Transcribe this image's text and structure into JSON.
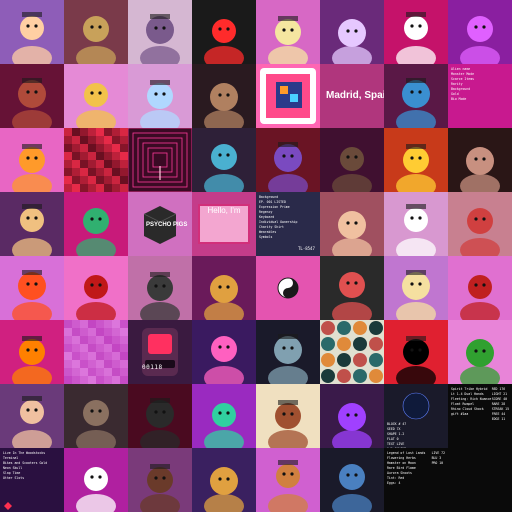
{
  "grid": {
    "columns": 8,
    "rows": 8,
    "tiles": [
      {
        "bg": "#8e5db8",
        "fg": "#ffcfa3",
        "icon": "robot-avatar"
      },
      {
        "bg": "#7a3a4a",
        "fg": "#c8a15a",
        "icon": "samurai-figure"
      },
      {
        "bg": "#d5b7d2",
        "fg": "#7a5a8c",
        "icon": "pixel-knight"
      },
      {
        "bg": "#1a1a1a",
        "fg": "#ff2b2b",
        "icon": "pixel-punk"
      },
      {
        "bg": "#d768c5",
        "fg": "#f5e6a0",
        "icon": "punk-glasses"
      },
      {
        "bg": "#6a2a7a",
        "fg": "#e6c8ff",
        "icon": "city-skyline"
      },
      {
        "bg": "#c5126a",
        "fg": "#ffffff",
        "icon": "panda"
      },
      {
        "bg": "#8a1fa0",
        "fg": "#e060ff",
        "icon": "hooded-figure"
      },
      {
        "bg": "#661236",
        "fg": "#b04a3a",
        "icon": "gun-art"
      },
      {
        "bg": "#e58ad6",
        "fg": "#f2c24a",
        "icon": "cat-cap"
      },
      {
        "bg": "#d99ad6",
        "fg": "#b0d8ff",
        "icon": "mushroom"
      },
      {
        "bg": "#2a1a20",
        "fg": "#b08060",
        "icon": "creature-3d"
      },
      {
        "bg": "#ff66b3",
        "fg": "#ffffff",
        "icon": "app-cube"
      },
      {
        "bg": "#b0367d",
        "fg": "#ffffff",
        "icon": "city-card",
        "text": "Madrid, Spai"
      },
      {
        "bg": "#5a1846",
        "fg": "#3a8fd0",
        "icon": "alien-portrait"
      },
      {
        "bg": "#c8198f",
        "fg": "#ffffff",
        "icon": "text-list",
        "lines": [
          "Alien name",
          "Monster Mode",
          "Scarce Items",
          "Rarity",
          "Background",
          "Gold",
          "Bio Mode"
        ]
      },
      {
        "bg": "#e866c4",
        "fg": "#ff9a2a",
        "icon": "fox-pirate"
      },
      {
        "bg": "#5a0c1c",
        "fg": "#ff3050",
        "icon": "glitch-texture"
      },
      {
        "bg": "#3a0a24",
        "fg": "#ff3a9a",
        "icon": "tunnel"
      },
      {
        "bg": "#2e2038",
        "fg": "#4ab0d0",
        "icon": "doll-girl"
      },
      {
        "bg": "#6a1424",
        "fg": "#7a4ac0",
        "icon": "monster-pose"
      },
      {
        "bg": "#401030",
        "fg": "#6a4a3a",
        "icon": "woman-portrait"
      },
      {
        "bg": "#c83a1a",
        "fg": "#ffcc33",
        "icon": "ornament"
      },
      {
        "bg": "#2a1616",
        "fg": "#c89080",
        "icon": "figure-photo"
      },
      {
        "bg": "#5a2a64",
        "fg": "#f0c080",
        "icon": "pixel-king"
      },
      {
        "bg": "#c81a7a",
        "fg": "#30b070",
        "icon": "dragon"
      },
      {
        "bg": "#d070c0",
        "fg": "#2a2a2a",
        "icon": "psycho-cube",
        "text": "PSYCHO PIGS"
      },
      {
        "bg": "#c43c8a",
        "fg": "#c0185a",
        "icon": "hello-card",
        "text": "Hello, I'm"
      },
      {
        "bg": "#2a2a4a",
        "fg": "#ffffff",
        "icon": "info-list",
        "lines": [
          "Background",
          "EP. 001 LISTED",
          "Expression Prime",
          "Regency",
          "Keyboard",
          "Individual Ownership",
          "Charity Shirt",
          "Wearables",
          "Symbols"
        ],
        "code": "TL-8547"
      },
      {
        "bg": "#a05060",
        "fg": "#f0c0a0",
        "icon": "kiss-photo"
      },
      {
        "bg": "#d898d0",
        "fg": "#ffffff",
        "icon": "cat-cartoon"
      },
      {
        "bg": "#c88090",
        "fg": "#d04040",
        "icon": "landscape"
      },
      {
        "bg": "#d870d8",
        "fg": "#ff5020",
        "icon": "bird-hero"
      },
      {
        "bg": "#f070c8",
        "fg": "#c01818",
        "icon": "red-ball-pixel"
      },
      {
        "bg": "#c070a8",
        "fg": "#3a3a3a",
        "icon": "horse-shadows"
      },
      {
        "bg": "#6a1a5a",
        "fg": "#e0a040",
        "icon": "tiger-woman"
      },
      {
        "bg": "#e454b0",
        "fg": "#1a1a1a",
        "icon": "yin-yang"
      },
      {
        "bg": "#2a2a2a",
        "fg": "#e05050",
        "icon": "mermaid"
      },
      {
        "bg": "#c076d0",
        "fg": "#f5e0a0",
        "icon": "bearded-cube"
      },
      {
        "bg": "#e070d0",
        "fg": "#c02020",
        "icon": "monkey"
      },
      {
        "bg": "#d02080",
        "fg": "#ff8000",
        "icon": "fist-astronaut"
      },
      {
        "bg": "#c040c0",
        "fg": "#e080e0",
        "icon": "blurred-pixel"
      },
      {
        "bg": "#3a1a40",
        "fg": "#ff3060",
        "icon": "counter-device",
        "text": "00118"
      },
      {
        "bg": "#3a1a60",
        "fg": "#ff60c0",
        "icon": "octopus-bot"
      },
      {
        "bg": "#1a1a2a",
        "fg": "#80a0b0",
        "icon": "dragon-head"
      },
      {
        "bg": "#e0e0d0",
        "fg": "#1a1a1a",
        "icon": "geometric-pattern"
      },
      {
        "bg": "#e02030",
        "fg": "#000000",
        "icon": "ink-face"
      },
      {
        "bg": "#e884d8",
        "fg": "#30a030",
        "icon": "pepe-soldier"
      },
      {
        "bg": "#6a3a7a",
        "fg": "#f0c0a0",
        "icon": "bald-man"
      },
      {
        "bg": "#3a2a30",
        "fg": "#8a7060",
        "icon": "beast-mech"
      },
      {
        "bg": "#4a0a20",
        "fg": "#2a2a2a",
        "icon": "dark-mech"
      },
      {
        "bg": "#9a2ac0",
        "fg": "#30d0a0",
        "icon": "dog-jester"
      },
      {
        "bg": "#f0e0c0",
        "fg": "#a05030",
        "icon": "anime-girl"
      },
      {
        "bg": "#3a1a4a",
        "fg": "#a040ff",
        "icon": "purple-monster"
      },
      {
        "bg": "#1a1a2a",
        "fg": "#6080ff",
        "icon": "planet-text",
        "lines": [
          "BLOCK # 47",
          "SEED 7X",
          "SHAPE 1.2",
          "FLAT 0",
          "TEXT LIVE",
          "1/1 ONLINE"
        ]
      },
      {
        "bg": "#0a0a0a",
        "fg": "#ffffff",
        "icon": "metadata",
        "lines": [
          "Spirit Tribe Hybrid",
          "Lt 1.4 Dual Hands",
          "Fleeting: Rich Nuance",
          "Float Rumpel",
          "Rhino Cloud Shock",
          "gift #1aa"
        ],
        "side": [
          "RED 176",
          "LIGHT 21",
          "SCORE 40",
          "RARE 28",
          "STREAK 15",
          "FREE 44",
          "EDGE 11"
        ]
      },
      {
        "bg": "#2a1040",
        "fg": "#ffffff",
        "icon": "terminal-list",
        "lines": [
          "Live In The Woodstocks",
          "Terminal",
          "Bikes and Scooters Gold",
          "Neon Skull",
          "Slap Time",
          "Other Slots"
        ]
      },
      {
        "bg": "#b020a0",
        "fg": "#ffffff",
        "icon": "retro-computer"
      },
      {
        "bg": "#7a3a7a",
        "fg": "#6a3a2a",
        "icon": "desert-landscape"
      },
      {
        "bg": "#3a2060",
        "fg": "#e0a040",
        "icon": "leopard-warrior"
      },
      {
        "bg": "#d060d0",
        "fg": "#d08040",
        "icon": "teddy-robot"
      },
      {
        "bg": "#1a1a2a",
        "fg": "#4a80c0",
        "icon": "soldier-figure"
      },
      {
        "bg": "#0a0a0a",
        "fg": "#ffffff",
        "icon": "stats-list",
        "lines": [
          "Legend of Lost Lands",
          "Flowering Herbs",
          "Hamster on Moon",
          "Rare Bird Flame",
          "Aurora Shoots",
          "Tint: Red",
          "Eggs: 4"
        ],
        "side": [
          "LIVE 72",
          "BLU 3",
          "PRO 10"
        ]
      },
      {
        "bg": "#0a0a0a",
        "fg": "#ffffff",
        "icon": "blank-dark"
      }
    ]
  }
}
